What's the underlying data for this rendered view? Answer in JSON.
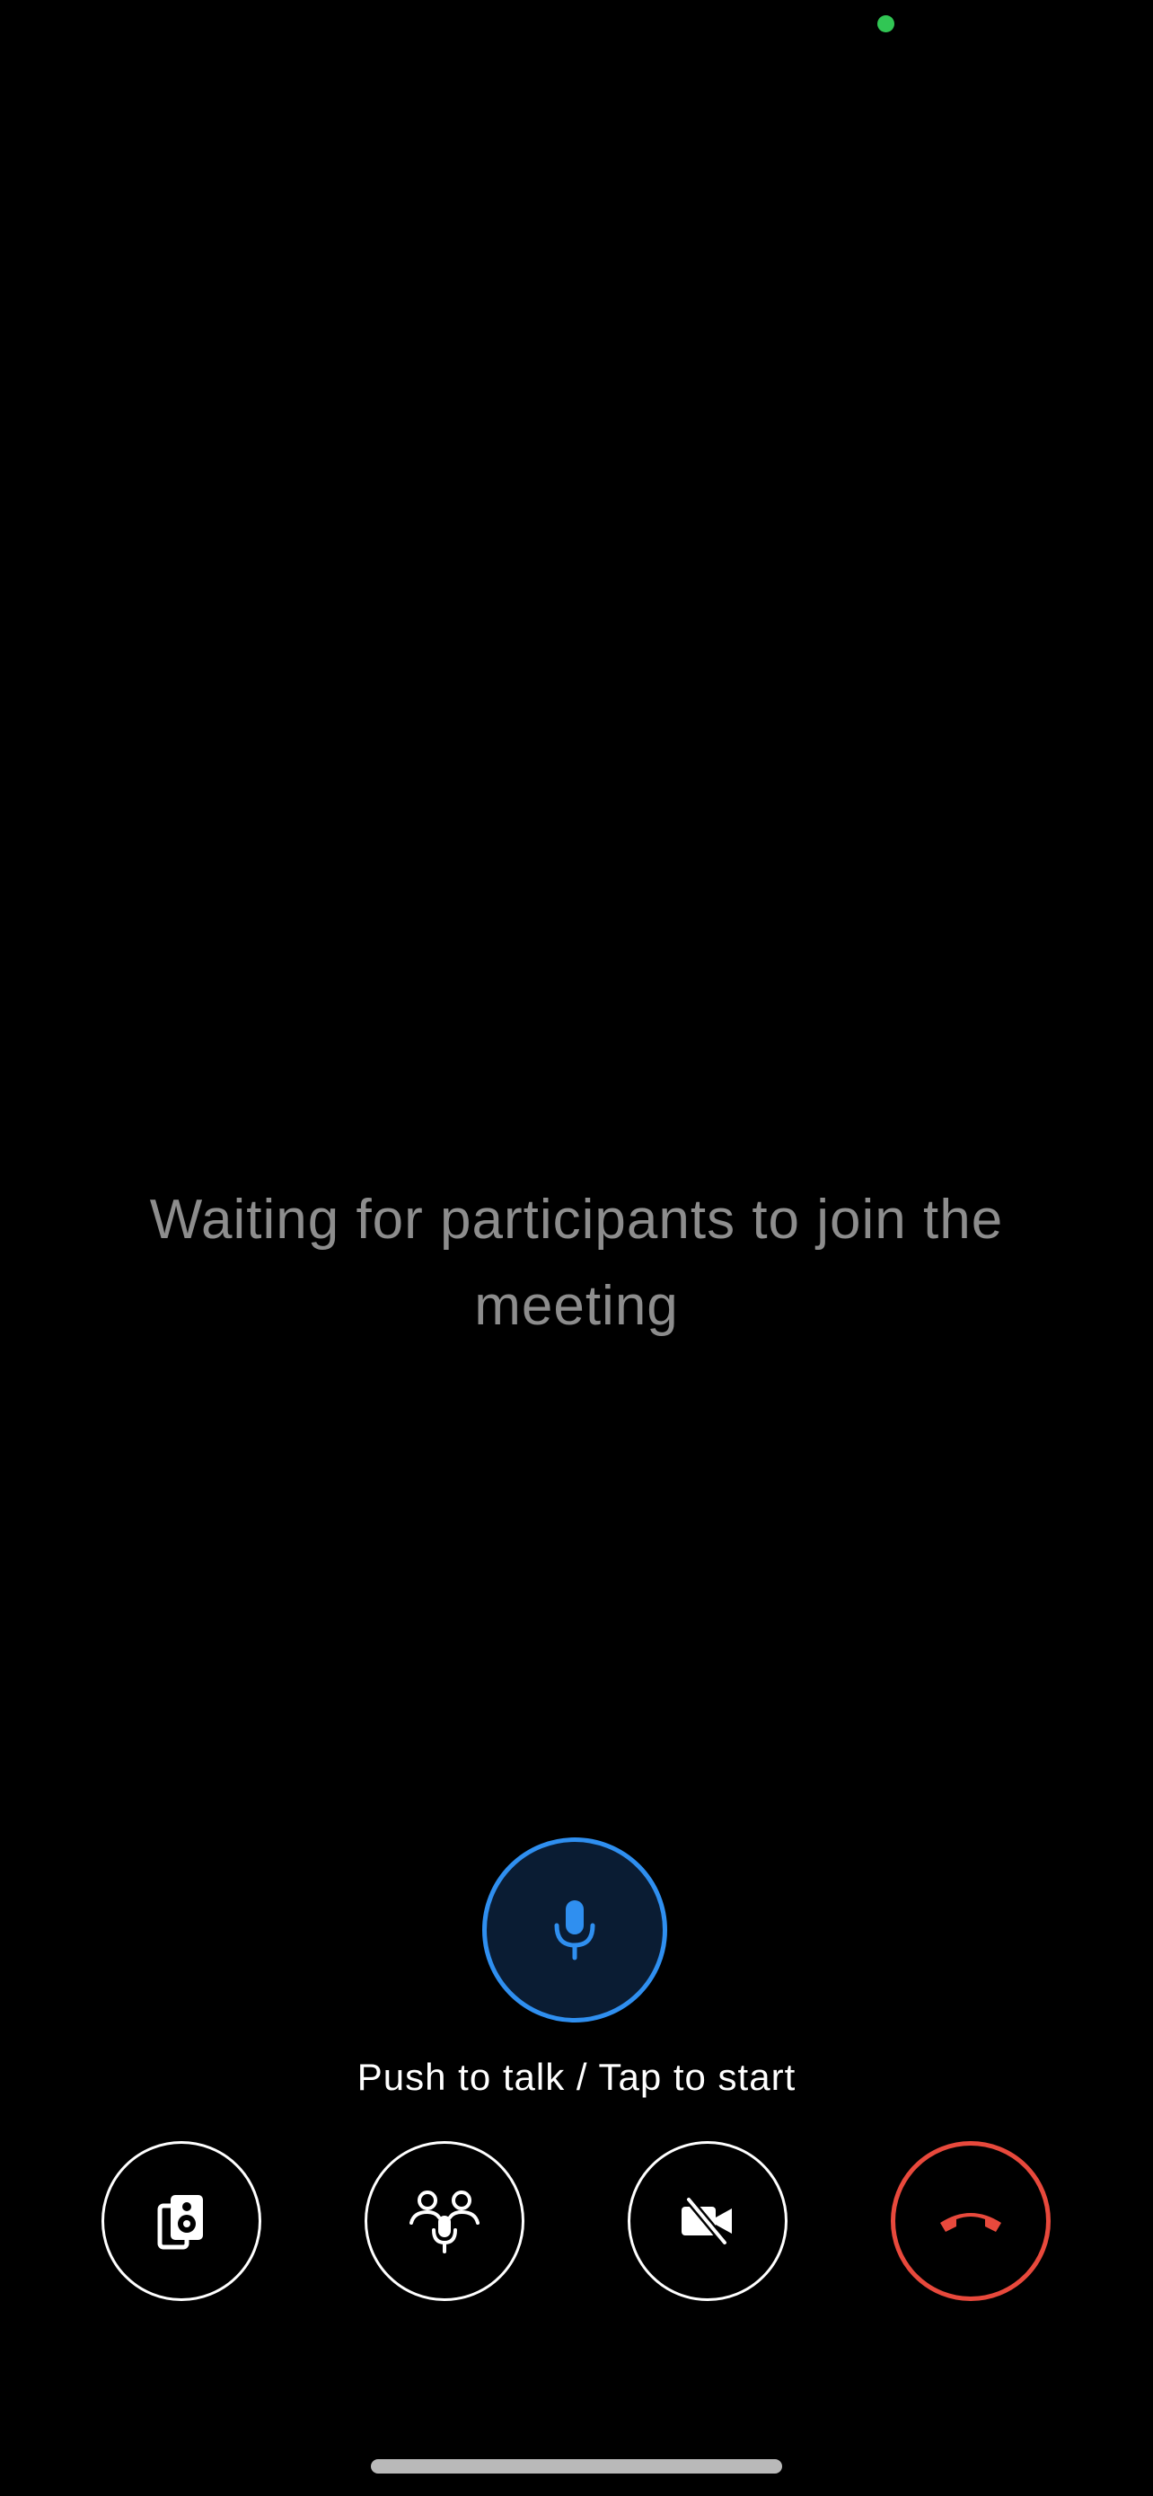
{
  "colors": {
    "background": "#000000",
    "status_indicator": "#31c654",
    "waiting_text": "#8d8d8d",
    "ptt_accent": "#2f8ff0",
    "ptt_fill": "#0a1c33",
    "end_call": "#e8493c",
    "control_stroke": "#ffffff",
    "label_text": "#ffffff"
  },
  "status": {
    "indicator_icon": "green-dot-icon"
  },
  "main": {
    "waiting_message": "Waiting for participants to join the meeting"
  },
  "push_to_talk": {
    "icon": "microphone-icon",
    "label": "Push to talk / Tap to start"
  },
  "controls": [
    {
      "id": "speaker",
      "icon": "speaker-icon"
    },
    {
      "id": "participants",
      "icon": "participants-icon"
    },
    {
      "id": "camera",
      "icon": "video-off-icon"
    },
    {
      "id": "end-call",
      "icon": "end-call-icon"
    }
  ]
}
